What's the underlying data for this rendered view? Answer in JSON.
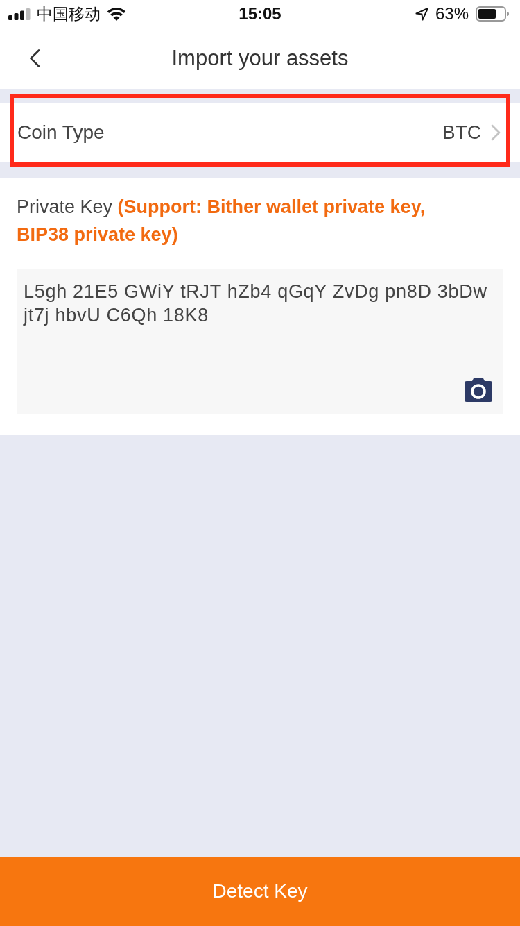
{
  "status_bar": {
    "carrier": "中国移动",
    "time": "15:05",
    "battery": "63%"
  },
  "nav_bar": {
    "title": "Import your assets"
  },
  "coin_type": {
    "label": "Coin Type",
    "value": "BTC",
    "highlighted": true
  },
  "private_key": {
    "label": "Private Key **(Support: Bither wallet private key, BIP38 private key)**",
    "value": "L5gh 21E5 GWiY tRJT hZb4 qGqY ZvDg pn8D 3bDw jt7j hbvU C6Qh 18K8"
  },
  "detect_button": {
    "label": "Detect Key"
  }
}
